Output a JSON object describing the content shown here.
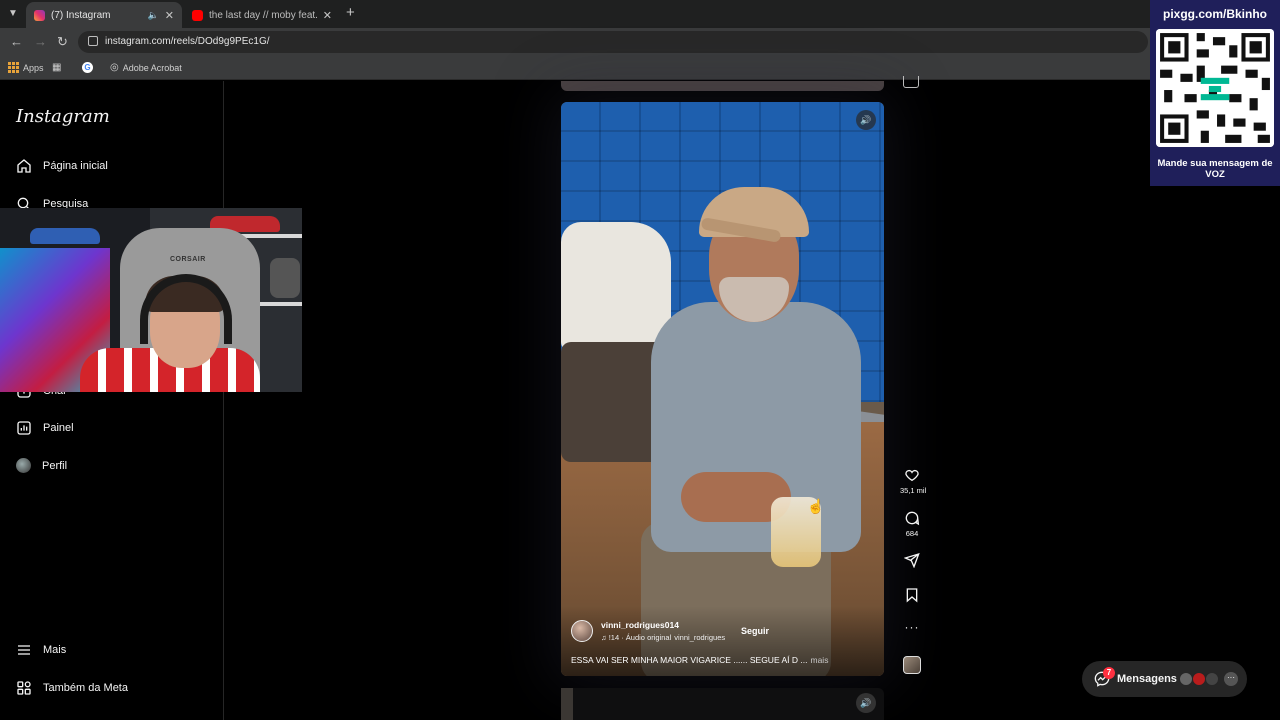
{
  "browser": {
    "tabs": [
      {
        "title": "(7) Instagram",
        "favicon": "instagram-favicon",
        "active": true
      },
      {
        "title": "the last day // moby feat. skylar",
        "favicon": "youtube-favicon",
        "active": false
      }
    ],
    "url": "instagram.com/reels/DOd9g9PEc1G/",
    "bookmarks": {
      "apps": "Apps",
      "acrobat": "Adobe Acrobat"
    }
  },
  "sidebar": {
    "logo": "Instagram",
    "items": [
      {
        "label": "Página inicial",
        "icon": "home-icon"
      },
      {
        "label": "Pesquisa",
        "icon": "search-icon"
      },
      {
        "label": "Criar",
        "icon": "create-icon"
      },
      {
        "label": "Painel",
        "icon": "dashboard-icon"
      },
      {
        "label": "Perfil",
        "icon": "profile-avatar"
      },
      {
        "label": "Mais",
        "icon": "menu-icon"
      },
      {
        "label": "Também da Meta",
        "icon": "meta-icon"
      }
    ]
  },
  "webcam": {
    "chair_brand": "CORSAIR"
  },
  "reel": {
    "username": "vinni_rodrigues014",
    "audio_prefix": "♫ !14 · Áudio original",
    "audio_owner": "vinni_rodrigues",
    "follow_label": "Seguir",
    "caption": "ESSA VAI SER MINHA MAIOR VIGARICE ...... SEGUE AÍ D ...",
    "more_label": "mais"
  },
  "actions": {
    "likes": "35,1 mil",
    "comments": "684"
  },
  "overlay": {
    "url": "pixgg.com/Bkinho",
    "note": "Mande sua mensagem de VOZ"
  },
  "messages": {
    "label": "Mensagens",
    "badge": "7"
  },
  "colors": {
    "background": "#000000",
    "notification_red": "#ff3040",
    "qr_card": "#1f1f5a"
  }
}
